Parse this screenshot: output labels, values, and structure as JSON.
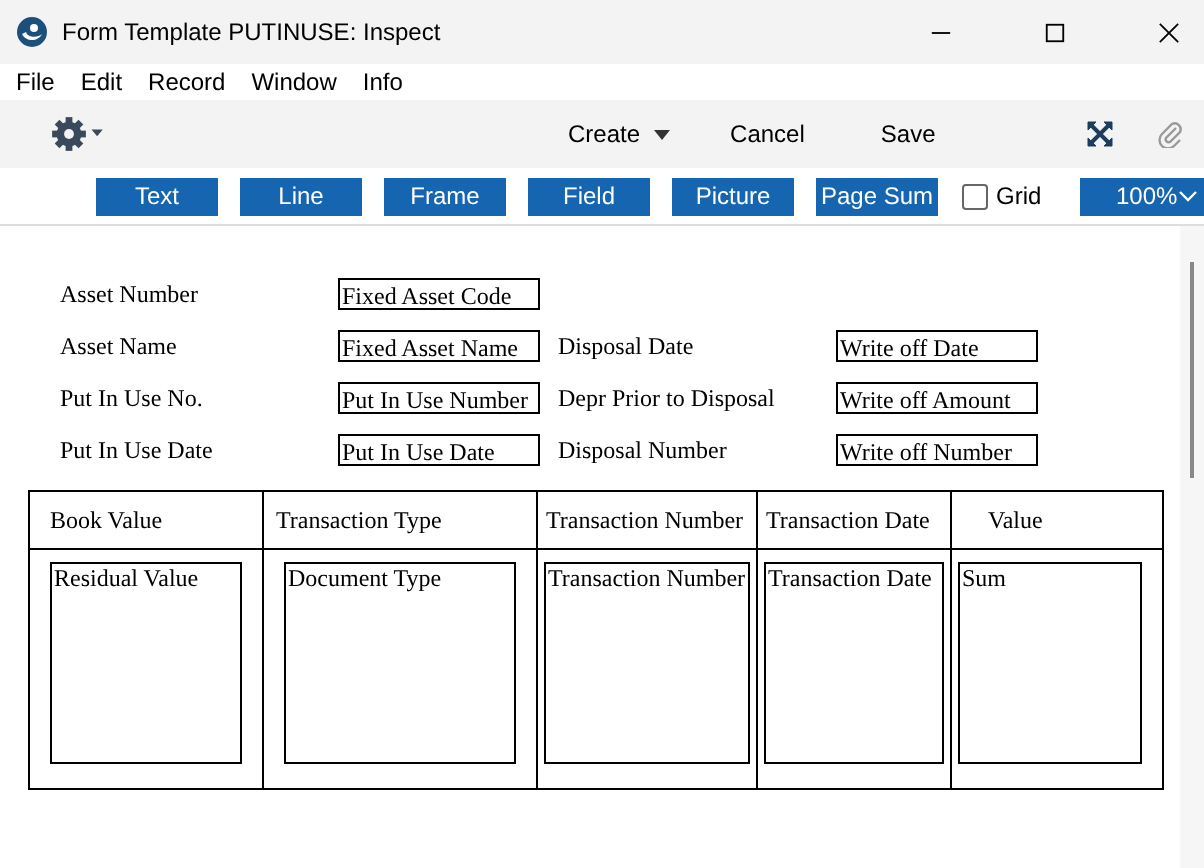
{
  "window": {
    "title": "Form Template PUTINUSE: Inspect"
  },
  "menu": [
    "File",
    "Edit",
    "Record",
    "Window",
    "Info"
  ],
  "toolbar": {
    "actions": [
      {
        "label": "Create",
        "dropdown": true
      },
      {
        "label": "Cancel",
        "dropdown": false
      },
      {
        "label": "Save",
        "dropdown": false
      }
    ]
  },
  "tools": [
    "Text",
    "Line",
    "Frame",
    "Field",
    "Picture",
    "Page Sum"
  ],
  "grid": {
    "label": "Grid",
    "checked": false
  },
  "zoom": {
    "value": "100%"
  },
  "header_rows": [
    {
      "label": "Asset Number",
      "field": "Fixed Asset Code"
    },
    {
      "label": "Asset Name",
      "field": "Fixed Asset Name",
      "label_2": "Disposal Date",
      "field_2": "Write off Date"
    },
    {
      "label": "Put In Use No.",
      "field": "Put In Use Number",
      "label_2": "Depr Prior to Disposal",
      "field_2": "Write off Amount"
    },
    {
      "label": "Put In Use Date",
      "field": "Put In Use Date",
      "label_2": "Disposal Number",
      "field_2": "Write off Number"
    }
  ],
  "table": {
    "columns": [
      {
        "heading": "Book Value",
        "field": "Residual Value"
      },
      {
        "heading": "Transaction Type",
        "field": "Document Type"
      },
      {
        "heading": "Transaction Number",
        "field": "Transaction Number"
      },
      {
        "heading": "Transaction Date",
        "field": "Transaction Date"
      },
      {
        "heading": "Value",
        "field": "Sum"
      }
    ]
  }
}
